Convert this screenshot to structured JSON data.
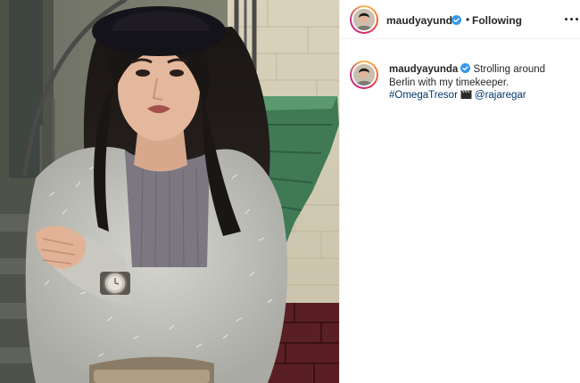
{
  "post": {
    "username": "maudyayunda",
    "separator": "•",
    "follow_status": "Following",
    "verified_icon": "verified-badge-icon",
    "more_icon": "more-options-icon"
  },
  "caption": {
    "username": "maudyayunda",
    "text": "Strolling around Berlin with my timekeeper.",
    "hashtag": "#OmegaTresor",
    "emoji": "clapper-board-icon",
    "mention": "@rajaregar"
  },
  "colors": {
    "verified": "#3897f0",
    "link": "#00376b",
    "text": "#262626",
    "divider": "#efefef"
  }
}
